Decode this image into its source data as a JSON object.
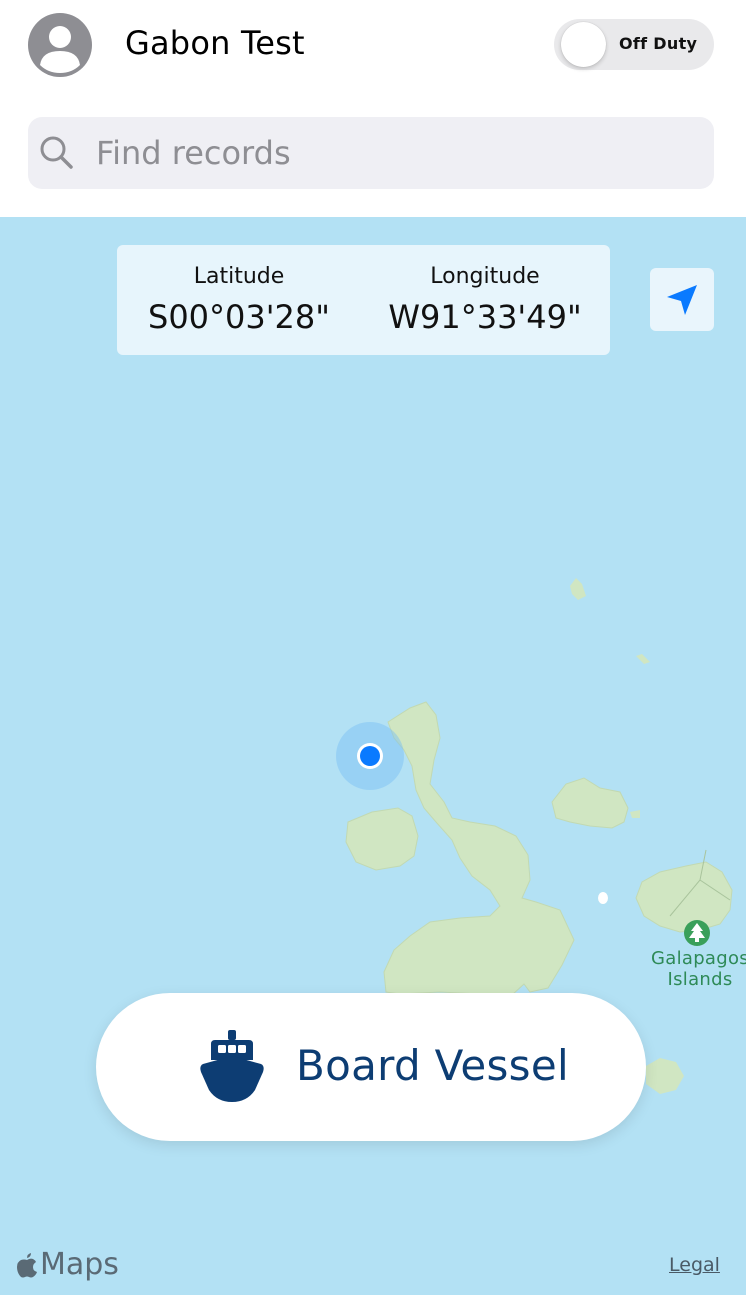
{
  "header": {
    "user_name": "Gabon Test",
    "duty_toggle": {
      "label": "Off Duty",
      "on": false
    }
  },
  "search": {
    "placeholder": "Find records",
    "value": ""
  },
  "location": {
    "latitude_label": "Latitude",
    "latitude_value": "S00°03'28\"",
    "longitude_label": "Longitude",
    "longitude_value": "W91°33'49\""
  },
  "map": {
    "park_label_line1": "Galapagos",
    "park_label_line2": "Islands",
    "attribution": "Maps",
    "legal_link": "Legal",
    "colors": {
      "water": "#b3e1f4",
      "land": "#d0e6c2",
      "user_dot": "#0a7aff",
      "park": "#3aa05a"
    }
  },
  "actions": {
    "board_vessel_label": "Board Vessel"
  },
  "icons": {
    "avatar": "person-circle-icon",
    "search": "magnifier-icon",
    "locate": "location-arrow-icon",
    "board": "ship-icon",
    "park": "tree-icon",
    "attribution": "apple-logo-icon"
  }
}
